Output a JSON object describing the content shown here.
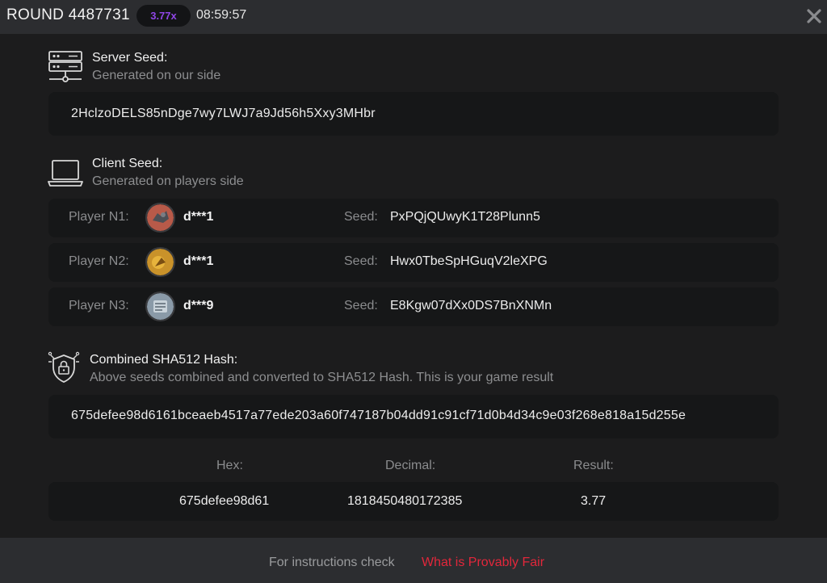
{
  "header": {
    "round_title": "ROUND 4487731",
    "multiplier": "3.77x",
    "time": "08:59:57",
    "close_icon": "close-icon"
  },
  "server_seed": {
    "title": "Server Seed:",
    "subtitle": "Generated on our side",
    "value": "2HclzoDELS85nDge7wy7LWJ7a9Jd56h5Xxy3MHbr",
    "icon": "server-icon"
  },
  "client_seed": {
    "title": "Client Seed:",
    "subtitle": "Generated on players side",
    "icon": "laptop-icon",
    "players": [
      {
        "label": "Player N1:",
        "name": "d***1",
        "seed_label": "Seed:",
        "seed": "PxPQjQUwyK1T28Plunn5",
        "avatar_color": "#b85a49"
      },
      {
        "label": "Player N2:",
        "name": "d***1",
        "seed_label": "Seed:",
        "seed": "Hwx0TbeSpHGuqV2leXPG",
        "avatar_color": "#c9922a"
      },
      {
        "label": "Player N3:",
        "name": "d***9",
        "seed_label": "Seed:",
        "seed": "E8Kgw07dXx0DS7BnXNMn",
        "avatar_color": "#8a9aa8"
      }
    ]
  },
  "combined": {
    "title": "Combined SHA512 Hash:",
    "subtitle": "Above seeds combined and converted to SHA512 Hash. This is your game result",
    "hash": "675defee98d6161bceaeb4517a77ede203a60f747187b04dd91c91cf71d0b4d34c9e03f268e818a15d255e",
    "icon": "shield-lock-icon"
  },
  "result": {
    "hex_label": "Hex:",
    "decimal_label": "Decimal:",
    "result_label": "Result:",
    "hex": "675defee98d61",
    "decimal": "1818450480172385",
    "result": "3.77"
  },
  "footer": {
    "text": "For instructions check",
    "link": "What is Provably Fair"
  },
  "colors": {
    "accent_purple": "#8f45e6",
    "link_red": "#e2273b"
  }
}
